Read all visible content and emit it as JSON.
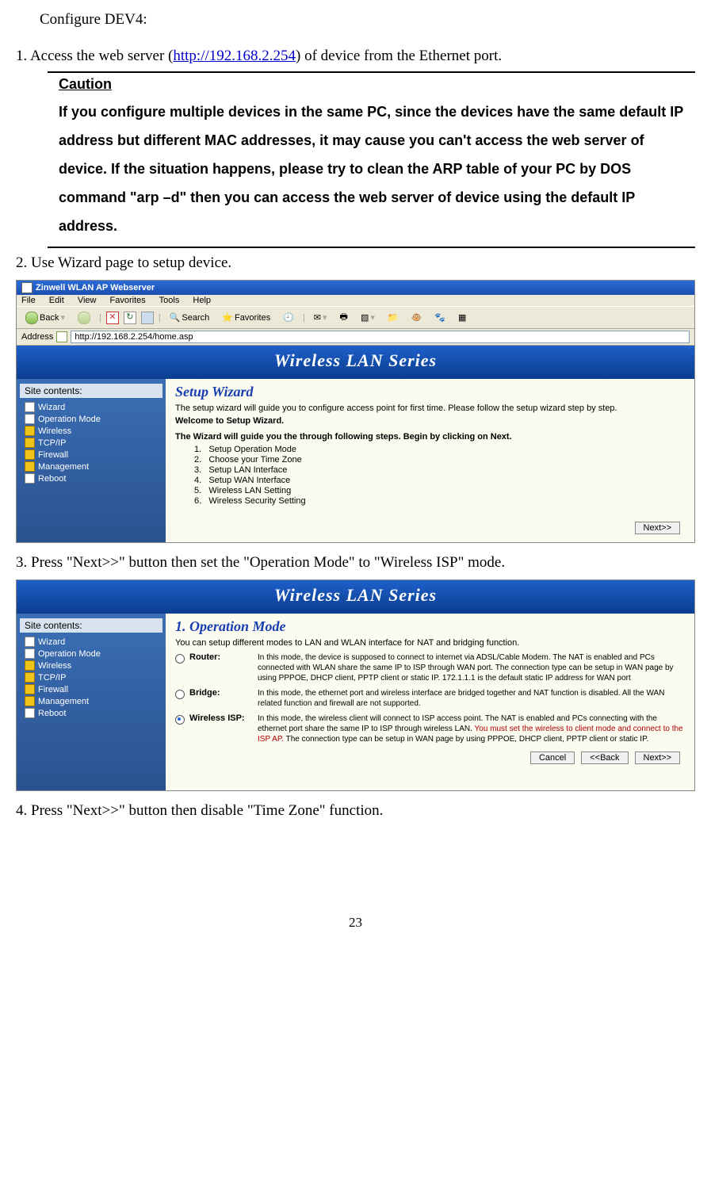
{
  "doc": {
    "title": "Configure DEV4:",
    "step1_pre": "1. Access the web server (",
    "step1_url": "http://192.168.2.254",
    "step1_post": ") of device from the Ethernet port.",
    "caution_title": "Caution",
    "caution_body": "If you configure multiple devices in the same PC, since the devices have the same default IP address but different MAC addresses, it may cause you can't access the web server of device. If the situation happens, please try to clean the ARP table of your PC by DOS command \"arp –d\" then you can access the web server of device using the default IP address.",
    "step2": "2. Use Wizard page to setup device.",
    "step3": "3. Press \"Next>>\" button then set the \"Operation Mode\" to \"Wireless ISP\" mode.",
    "step4": "4. Press \"Next>>\" button then disable \"Time Zone\" function.",
    "page_num": "23"
  },
  "ss1": {
    "window_title": "Zinwell WLAN AP Webserver",
    "menu": {
      "file": "File",
      "edit": "Edit",
      "view": "View",
      "fav": "Favorites",
      "tools": "Tools",
      "help": "Help"
    },
    "toolbar": {
      "back": "Back",
      "search": "Search",
      "favorites": "Favorites"
    },
    "address_label": "Address",
    "address_value": "http://192.168.2.254/home.asp",
    "banner": "Wireless LAN Series",
    "sidebar_title": "Site contents:",
    "sidebar_items": [
      "Wizard",
      "Operation Mode",
      "Wireless",
      "TCP/IP",
      "Firewall",
      "Management",
      "Reboot"
    ],
    "wizard_title": "Setup Wizard",
    "wizard_intro": "The setup wizard will guide you to configure access point for first time. Please follow the setup wizard step by step.",
    "wizard_welcome": "Welcome to Setup Wizard.",
    "wizard_guide": "The Wizard will guide you the through following steps. Begin by clicking on Next.",
    "steps": [
      "Setup Operation Mode",
      "Choose your Time Zone",
      "Setup LAN Interface",
      "Setup WAN Interface",
      "Wireless LAN Setting",
      "Wireless Security Setting"
    ],
    "next_label": "Next>>"
  },
  "ss2": {
    "banner": "Wireless LAN Series",
    "sidebar_title": "Site contents:",
    "sidebar_items": [
      "Wizard",
      "Operation Mode",
      "Wireless",
      "TCP/IP",
      "Firewall",
      "Management",
      "Reboot"
    ],
    "page_title": "1. Operation Mode",
    "intro": "You can setup different modes to LAN and WLAN interface for NAT and bridging function.",
    "modes": [
      {
        "name": "Router:",
        "selected": false,
        "desc": "In this mode, the device is supposed to connect to internet via ADSL/Cable Modem. The NAT is enabled and PCs connected with WLAN share the same IP to ISP through WAN port. The connection type can be setup in WAN page by using PPPOE, DHCP client, PPTP client or static IP. 172.1.1.1 is the default static IP address for WAN port"
      },
      {
        "name": "Bridge:",
        "selected": false,
        "desc": "In this mode, the ethernet port and wireless interface are bridged together and NAT function is disabled. All the WAN related function and firewall are not supported."
      },
      {
        "name": "Wireless ISP:",
        "selected": true,
        "desc_pre": "In this mode, the wireless client will connect to ISP access point. The NAT is enabled and PCs connecting with the ethernet port share the same IP to ISP through wireless LAN. ",
        "desc_red": "You must set the wireless to client mode and connect to the ISP AP.",
        "desc_post": " The connection type can be setup in WAN page by using PPPOE, DHCP client, PPTP client or static IP."
      }
    ],
    "btn_cancel": "Cancel",
    "btn_back": "<<Back",
    "btn_next": "Next>>"
  }
}
